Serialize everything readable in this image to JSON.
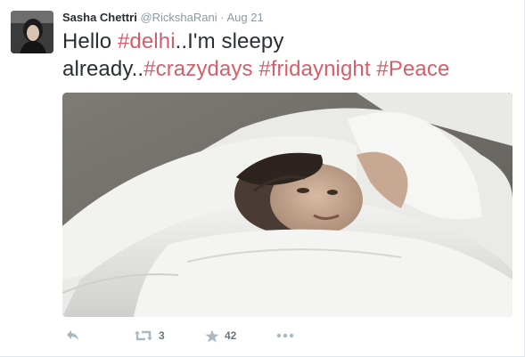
{
  "tweet": {
    "fullname": "Sasha Chettri",
    "username": "@RickshaRani",
    "separator": "·",
    "time": "Aug 21",
    "text_parts": {
      "p1": "Hello ",
      "h1": "#delhi",
      "p2": "..I'm sleepy",
      "p3": "already..",
      "h2": "#crazydays",
      "p4": " ",
      "h3": "#fridaynight",
      "p5": " ",
      "h4": "#Peace"
    },
    "hashtag_color": "#d35f6c"
  },
  "actions": {
    "retweet_count": "3",
    "favorite_count": "42",
    "icons": [
      "reply-icon",
      "retweet-icon",
      "favorite-star-icon",
      "more-icon"
    ]
  }
}
